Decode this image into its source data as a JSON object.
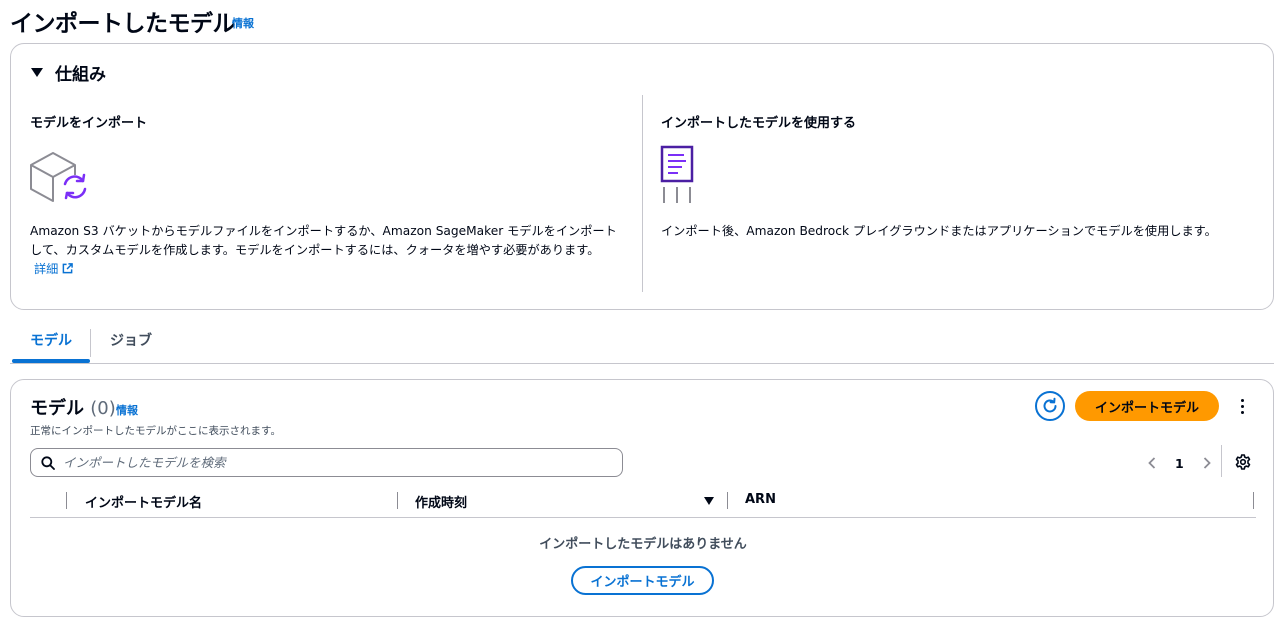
{
  "page": {
    "title": "インポートしたモデル",
    "info_label": "情報"
  },
  "how_it_works": {
    "title": "仕組み",
    "import": {
      "title": "モデルをインポート",
      "description": "Amazon S3 バケットからモデルファイルをインポートするか、Amazon SageMaker モデルをインポートして、カスタムモデルを作成します。モデルをインポートするには、クォータを増やす必要があります。",
      "learn_more": "詳細"
    },
    "use": {
      "title": "インポートしたモデルを使用する",
      "description": "インポート後、Amazon Bedrock プレイグラウンドまたはアプリケーションでモデルを使用します。"
    }
  },
  "tabs": [
    {
      "label": "モデル",
      "active": true
    },
    {
      "label": "ジョブ",
      "active": false
    }
  ],
  "models": {
    "title": "モデル",
    "count": "(0)",
    "info_label": "情報",
    "description": "正常にインポートしたモデルがここに表示されます。",
    "import_button": "インポートモデル",
    "search_placeholder": "インポートしたモデルを検索",
    "pagination": {
      "current_page": "1"
    },
    "columns": [
      "インポートモデル名",
      "作成時刻",
      "ARN"
    ],
    "empty_message": "インポートしたモデルはありません",
    "empty_button": "インポートモデル"
  },
  "colors": {
    "link": "#0972d3",
    "primary_button": "#ff9900",
    "icon_purple": "#7b2ff7",
    "border": "#c6c6cd"
  },
  "icons": [
    "cube-refresh-icon",
    "document-icon",
    "external-link-icon",
    "refresh-icon",
    "more-vertical-icon",
    "search-icon",
    "chevron-left-icon",
    "chevron-right-icon",
    "settings-gear-icon",
    "caret-down-icon",
    "sort-descending-icon"
  ]
}
